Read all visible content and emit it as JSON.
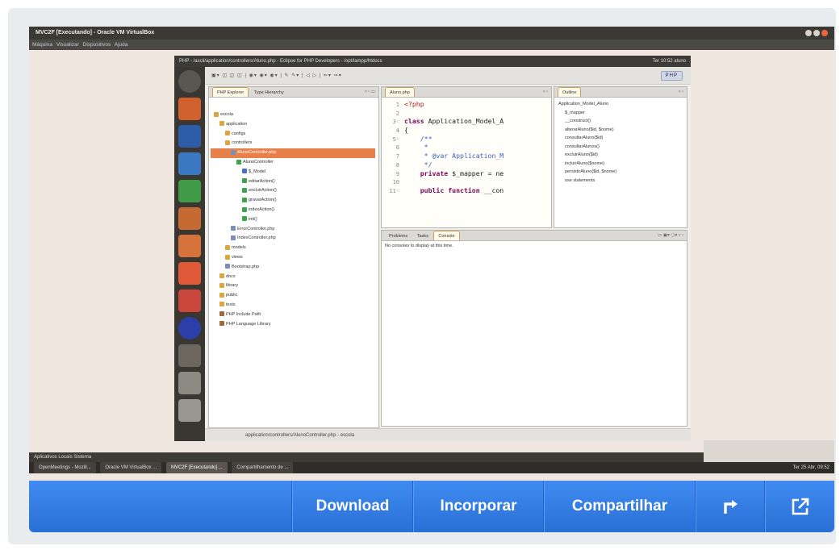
{
  "host_window": {
    "title": "MVC2F [Executando] - Oracle VM VirtualBox",
    "menu": [
      "Máquina",
      "Visualizar",
      "Dispositivos",
      "Ajuda"
    ]
  },
  "guest": {
    "title": "PHP - /ascii/application/controllers/Aluno.php - Eclipse for PHP Developers - /opt/lampp/htdocs",
    "tray": "Ter 10:52  aluno",
    "perspective": "PHP"
  },
  "explorer": {
    "tabs": [
      "PHP Explorer",
      "Type Hierarchy"
    ],
    "tree": [
      {
        "label": "escola",
        "depth": 0,
        "icon": "folder"
      },
      {
        "label": "application",
        "depth": 1,
        "icon": "folder"
      },
      {
        "label": "configs",
        "depth": 2,
        "icon": "folder"
      },
      {
        "label": "controllers",
        "depth": 2,
        "icon": "folder"
      },
      {
        "label": "AlunoController.php",
        "depth": 3,
        "icon": "file",
        "selected": true
      },
      {
        "label": "AlunoController",
        "depth": 4,
        "icon": "green"
      },
      {
        "label": "$_Model",
        "depth": 5,
        "icon": "blue"
      },
      {
        "label": "editarAction()",
        "depth": 5,
        "icon": "green"
      },
      {
        "label": "excluirAction()",
        "depth": 5,
        "icon": "green"
      },
      {
        "label": "gravarAction()",
        "depth": 5,
        "icon": "green"
      },
      {
        "label": "indexAction()",
        "depth": 5,
        "icon": "green"
      },
      {
        "label": "init()",
        "depth": 5,
        "icon": "green"
      },
      {
        "label": "ErrorController.php",
        "depth": 3,
        "icon": "file"
      },
      {
        "label": "IndexController.php",
        "depth": 3,
        "icon": "file"
      },
      {
        "label": "models",
        "depth": 2,
        "icon": "folder"
      },
      {
        "label": "views",
        "depth": 2,
        "icon": "folder"
      },
      {
        "label": "Bootstrap.php",
        "depth": 2,
        "icon": "file"
      },
      {
        "label": "docs",
        "depth": 1,
        "icon": "folder"
      },
      {
        "label": "library",
        "depth": 1,
        "icon": "folder"
      },
      {
        "label": "public",
        "depth": 1,
        "icon": "folder"
      },
      {
        "label": "tests",
        "depth": 1,
        "icon": "folder"
      },
      {
        "label": "PHP Include Path",
        "depth": 1,
        "icon": "lib"
      },
      {
        "label": "PHP Language Library",
        "depth": 1,
        "icon": "lib"
      }
    ]
  },
  "editor": {
    "tab": "Aluno.php",
    "lines": [
      {
        "n": "1",
        "segments": [
          {
            "t": "<?php",
            "c": "tag"
          }
        ]
      },
      {
        "n": "2",
        "segments": []
      },
      {
        "n": "3◦",
        "segments": [
          {
            "t": "class ",
            "c": "kw"
          },
          {
            "t": "Application_Model_A",
            "c": ""
          }
        ]
      },
      {
        "n": "4",
        "segments": [
          {
            "t": "{",
            "c": ""
          }
        ]
      },
      {
        "n": "5◦",
        "segments": [
          {
            "t": "    /**",
            "c": "cm"
          }
        ]
      },
      {
        "n": "6",
        "segments": [
          {
            "t": "     *",
            "c": "cm"
          }
        ]
      },
      {
        "n": "7",
        "segments": [
          {
            "t": "     * @var Application_M",
            "c": "cm"
          }
        ]
      },
      {
        "n": "8",
        "segments": [
          {
            "t": "     */",
            "c": "cm"
          }
        ]
      },
      {
        "n": "9",
        "segments": [
          {
            "t": "    private ",
            "c": "kw"
          },
          {
            "t": "$_mapper = ne",
            "c": ""
          }
        ]
      },
      {
        "n": "10",
        "segments": []
      },
      {
        "n": "11◦",
        "segments": [
          {
            "t": "    public function ",
            "c": "kw"
          },
          {
            "t": "__con",
            "c": ""
          }
        ]
      }
    ]
  },
  "outline": {
    "tab": "Outline",
    "items": [
      {
        "label": "Application_Model_Aluno",
        "icon": "green"
      },
      {
        "label": "$_mapper",
        "icon": "red"
      },
      {
        "label": "__construct()",
        "icon": "green"
      },
      {
        "label": "alterarAluno($id, $nome)",
        "icon": "green"
      },
      {
        "label": "consultarAluno($id)",
        "icon": "green"
      },
      {
        "label": "consultarAlunos()",
        "icon": "green"
      },
      {
        "label": "excluirAluno($id)",
        "icon": "green"
      },
      {
        "label": "incluirAluno($nome)",
        "icon": "red"
      },
      {
        "label": "persistirAluno($id, $nome)",
        "icon": "green"
      },
      {
        "label": "use statements",
        "icon": "lib"
      }
    ]
  },
  "console": {
    "tabs": [
      "Problems",
      "Tasks",
      "Console"
    ],
    "message": "No consoles to display at this time."
  },
  "status": {
    "path": "application/controllers/AlunoController.php - escola"
  },
  "host_panel": {
    "top": "Aplicativos  Locais  Sistema",
    "tasks": [
      {
        "label": "OpenMeetings - Mozill...",
        "active": false
      },
      {
        "label": "Oracle VM VirtualBox ...",
        "active": false
      },
      {
        "label": "MVC2F [Executando] ...",
        "active": true
      },
      {
        "label": "Compartilhamento de ...",
        "active": false
      }
    ],
    "clock": "Ter 25 Abr, 09:52"
  },
  "controls": {
    "download": "Download",
    "embed": "Incorporar",
    "share": "Compartilhar"
  }
}
